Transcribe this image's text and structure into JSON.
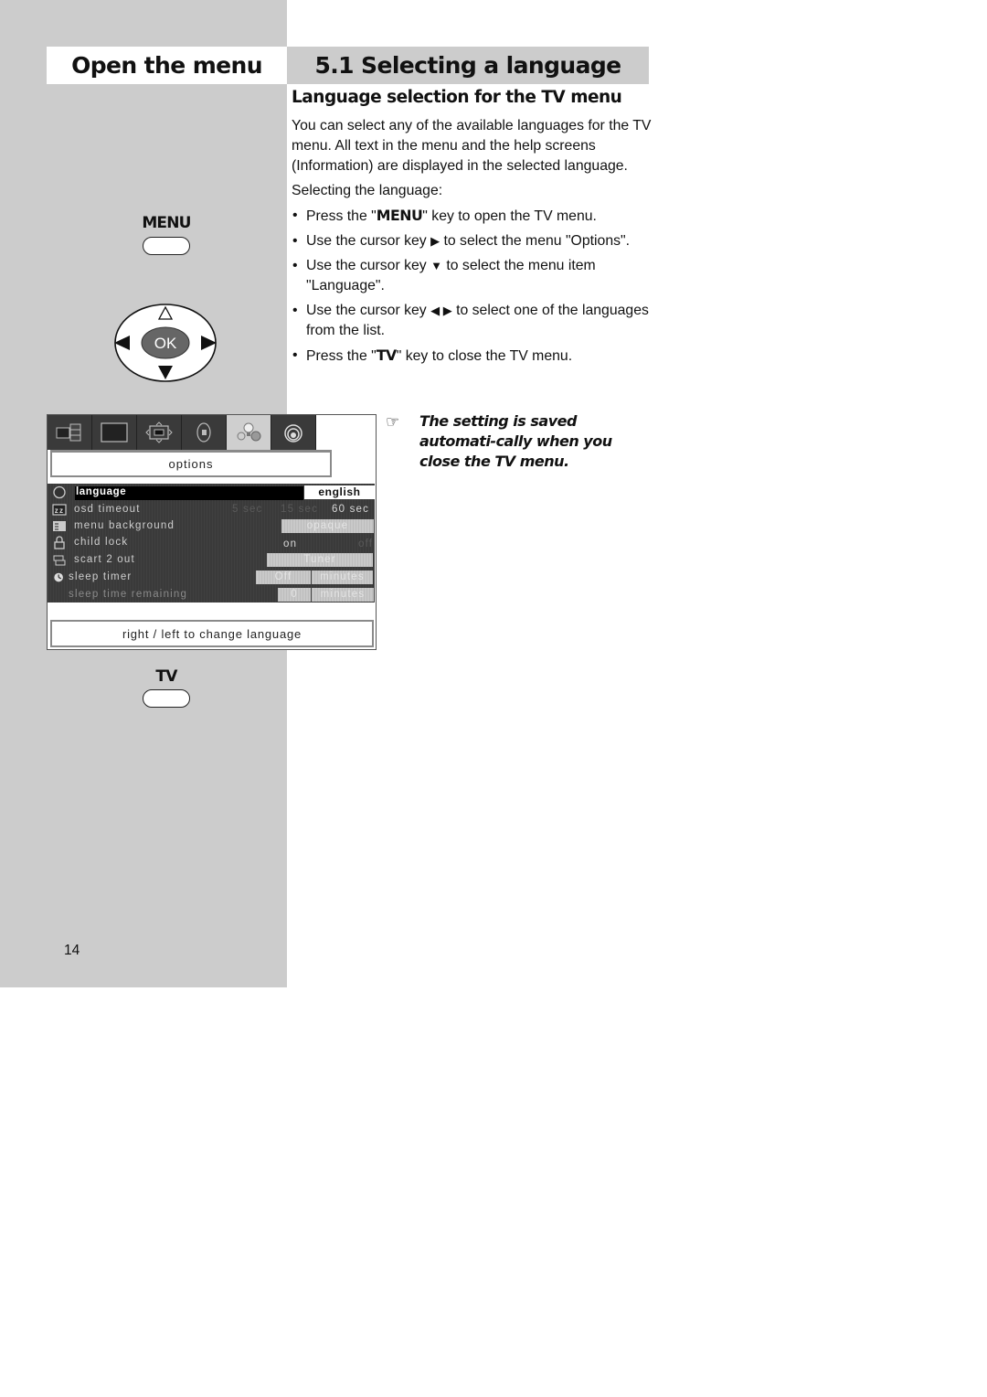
{
  "header": {
    "left_title": "Open the menu",
    "right_title": "5.1 Selecting a language"
  },
  "section": {
    "subheading": "Language selection for the TV menu",
    "intro": "You can select any of the available languages for the TV menu. All text in the menu and the help screens (Information) are displayed in the selected language.",
    "steps_heading": "Selecting the language:",
    "steps": [
      {
        "pre": "Press the \"",
        "key": "MENU",
        "post": "\" key to open the TV menu."
      },
      {
        "pre": "Use the cursor key ",
        "key": "▶",
        "post": " to select the menu \"Options\"."
      },
      {
        "pre": "Use the cursor key ",
        "key": "▼",
        "post": " to select the menu item \"Language\"."
      },
      {
        "pre": "Use the cursor key ",
        "key": "◀ ▶",
        "post": " to select one of the languages from the list."
      },
      {
        "pre": "Press the \"",
        "key": "TV",
        "post": "\" key to close the TV menu."
      }
    ],
    "bullet": "•",
    "note_icon": "pointing-hand-icon",
    "note_glyph": "☞",
    "note": "The setting is saved automati-cally when you close the TV menu."
  },
  "remote": {
    "menu_key_label": "MENU",
    "ok_label": "OK",
    "tv_key_label": "TV"
  },
  "tv_menu": {
    "tabs": [
      {
        "icon": "picture-in-picture-icon",
        "active": false
      },
      {
        "icon": "screen-icon",
        "active": false
      },
      {
        "icon": "geometry-icon",
        "active": false
      },
      {
        "icon": "speaker-icon",
        "active": false
      },
      {
        "icon": "options-icon",
        "active": true
      },
      {
        "icon": "signal-icon",
        "active": false
      }
    ],
    "title": "options",
    "rows": [
      {
        "icon": "globe-icon",
        "label": "language",
        "value": "english",
        "selected": true
      },
      {
        "icon": "sleep-zz-icon",
        "label": "osd timeout",
        "options": [
          "5 sec",
          "15 sec",
          "60 sec"
        ],
        "current": "60 sec"
      },
      {
        "icon": "menu-background-icon",
        "label": "menu background",
        "value": "opaque"
      },
      {
        "icon": "lock-icon",
        "label": "child lock",
        "options": [
          "on",
          "off"
        ],
        "current": "on"
      },
      {
        "icon": "scart-icon",
        "label": "scart 2 out",
        "value": "Tuner"
      },
      {
        "icon": "clock-icon",
        "label": "sleep timer",
        "value": "Off",
        "unit": "minutes"
      },
      {
        "icon": "",
        "label": "sleep time remaining",
        "value": "0",
        "unit": "minutes"
      }
    ],
    "hint": "right /  left to change language"
  },
  "footer": {
    "page_number": "14"
  },
  "colors": {
    "panel_grey": "#cccccc",
    "menu_dark": "#3a3a3a",
    "selected_bar": "#000000"
  }
}
